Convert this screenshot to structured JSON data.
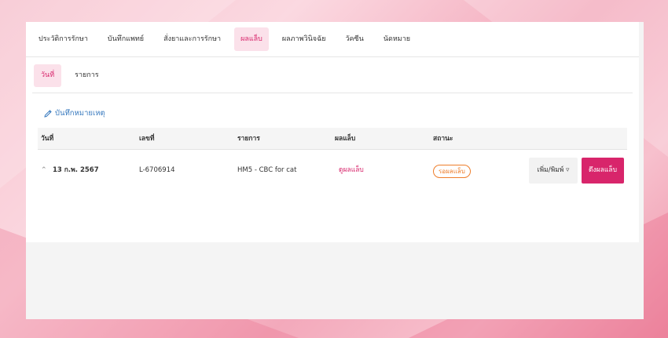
{
  "tabs": [
    {
      "label": "ประวัติการรักษา"
    },
    {
      "label": "บันทึกแพทย์"
    },
    {
      "label": "สั่งยาและการรักษา"
    },
    {
      "label": "ผลแล็บ",
      "active": true
    },
    {
      "label": "ผลภาพวินิจฉัย"
    },
    {
      "label": "วัคซีน"
    },
    {
      "label": "นัดหมาย"
    }
  ],
  "subtabs": [
    {
      "label": "วันที่",
      "active": true
    },
    {
      "label": "รายการ"
    }
  ],
  "note_link": {
    "label": "บันทึกหมายเหตุ",
    "icon": "pencil-icon"
  },
  "table": {
    "headers": [
      "วันที่",
      "เลขที่",
      "รายการ",
      "ผลแล็บ",
      "สถานะ"
    ],
    "rows": [
      {
        "date": "13 ก.พ. 2567",
        "number": "L-6706914",
        "item": "HM5 - CBC for cat",
        "result_link": "ดูผลแล็บ",
        "status": "รอผลแล็บ",
        "print_button": "เพิ่ม/พิมพ์",
        "pull_button": "ดึงผลแล็บ"
      }
    ]
  },
  "colors": {
    "accent": "#d8256b",
    "link": "#3a7bbf",
    "status": "#ee7d2a"
  }
}
